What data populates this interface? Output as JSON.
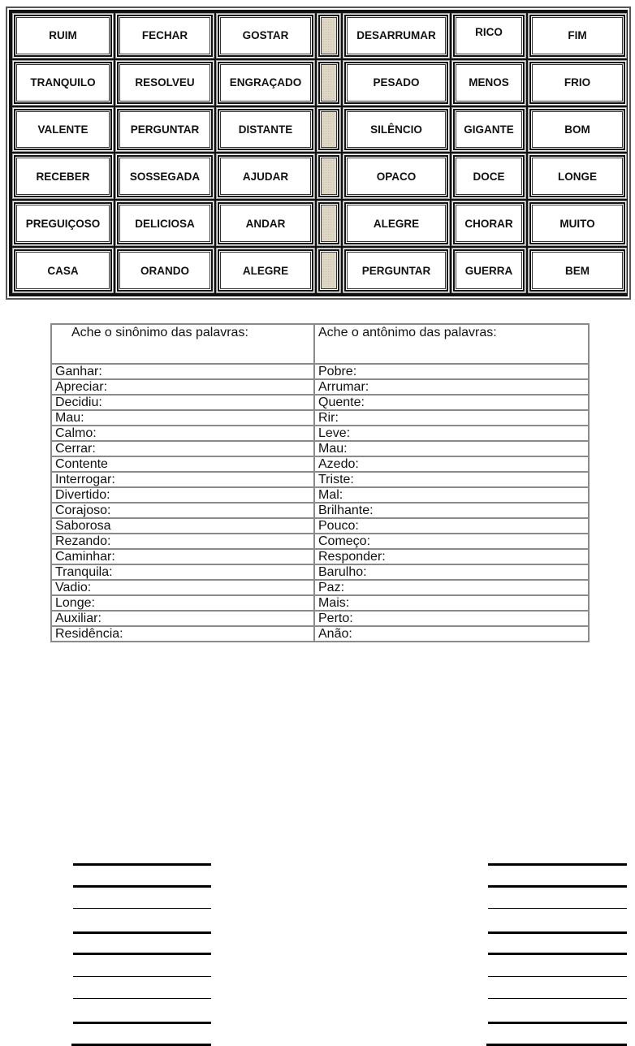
{
  "word_grid": {
    "spacer_color": "#ddd6c4",
    "left_block": [
      [
        "RUIM",
        "FECHAR",
        "GOSTAR"
      ],
      [
        "TRANQUILO",
        "RESOLVEU",
        "ENGRAÇADO"
      ],
      [
        "VALENTE",
        "PERGUNTAR",
        "DISTANTE"
      ],
      [
        "RECEBER",
        "SOSSEGADA",
        "AJUDAR"
      ],
      [
        "PREGUIÇOSO",
        "DELICIOSA",
        "ANDAR"
      ],
      [
        "CASA",
        "ORANDO",
        "ALEGRE"
      ]
    ],
    "right_block": [
      [
        "DESARRUMAR",
        "RICO",
        "FIM"
      ],
      [
        "PESADO",
        "MENOS",
        "FRIO"
      ],
      [
        "SILÊNCIO",
        "GIGANTE",
        "BOM"
      ],
      [
        "OPACO",
        "DOCE",
        "LONGE"
      ],
      [
        "ALEGRE",
        "CHORAR",
        "MUITO"
      ],
      [
        "PERGUNTAR",
        "GUERRA",
        "BEM"
      ]
    ]
  },
  "exercise_table": {
    "header_synonym": "Ache o sinônimo das palavras:",
    "header_antonym": "Ache o antônimo das palavras:",
    "rows": [
      {
        "synonym": "Ganhar:",
        "antonym": "Pobre:"
      },
      {
        "synonym": "Apreciar:",
        "antonym": "Arrumar:"
      },
      {
        "synonym": "Decidiu:",
        "antonym": "Quente:"
      },
      {
        "synonym": "Mau:",
        "antonym": "Rir:"
      },
      {
        "synonym": "Calmo:",
        "antonym": "Leve:"
      },
      {
        "synonym": "Cerrar:",
        "antonym": "Mau:"
      },
      {
        "synonym": "Contente",
        "antonym": "Azedo:"
      },
      {
        "synonym": "Interrogar:",
        "antonym": "Triste:"
      },
      {
        "synonym": "Divertido:",
        "antonym": "Mal:"
      },
      {
        "synonym": "Corajoso:",
        "antonym": "Brilhante:"
      },
      {
        "synonym": "Saborosa",
        "antonym": "Pouco:"
      },
      {
        "synonym": "Rezando:",
        "antonym": "Começo:"
      },
      {
        "synonym": "Caminhar:",
        "antonym": "Responder:"
      },
      {
        "synonym": "Tranquila:",
        "antonym": "Barulho:"
      },
      {
        "synonym": "Vadio:",
        "antonym": "Paz:"
      },
      {
        "synonym": "Longe:",
        "antonym": "Mais:"
      },
      {
        "synonym": "Auxiliar:",
        "antonym": "Perto:"
      },
      {
        "synonym": "Residência:",
        "antonym": "Anão:"
      }
    ]
  },
  "answer_lines": {
    "left_count": 9,
    "right_count": 9
  }
}
